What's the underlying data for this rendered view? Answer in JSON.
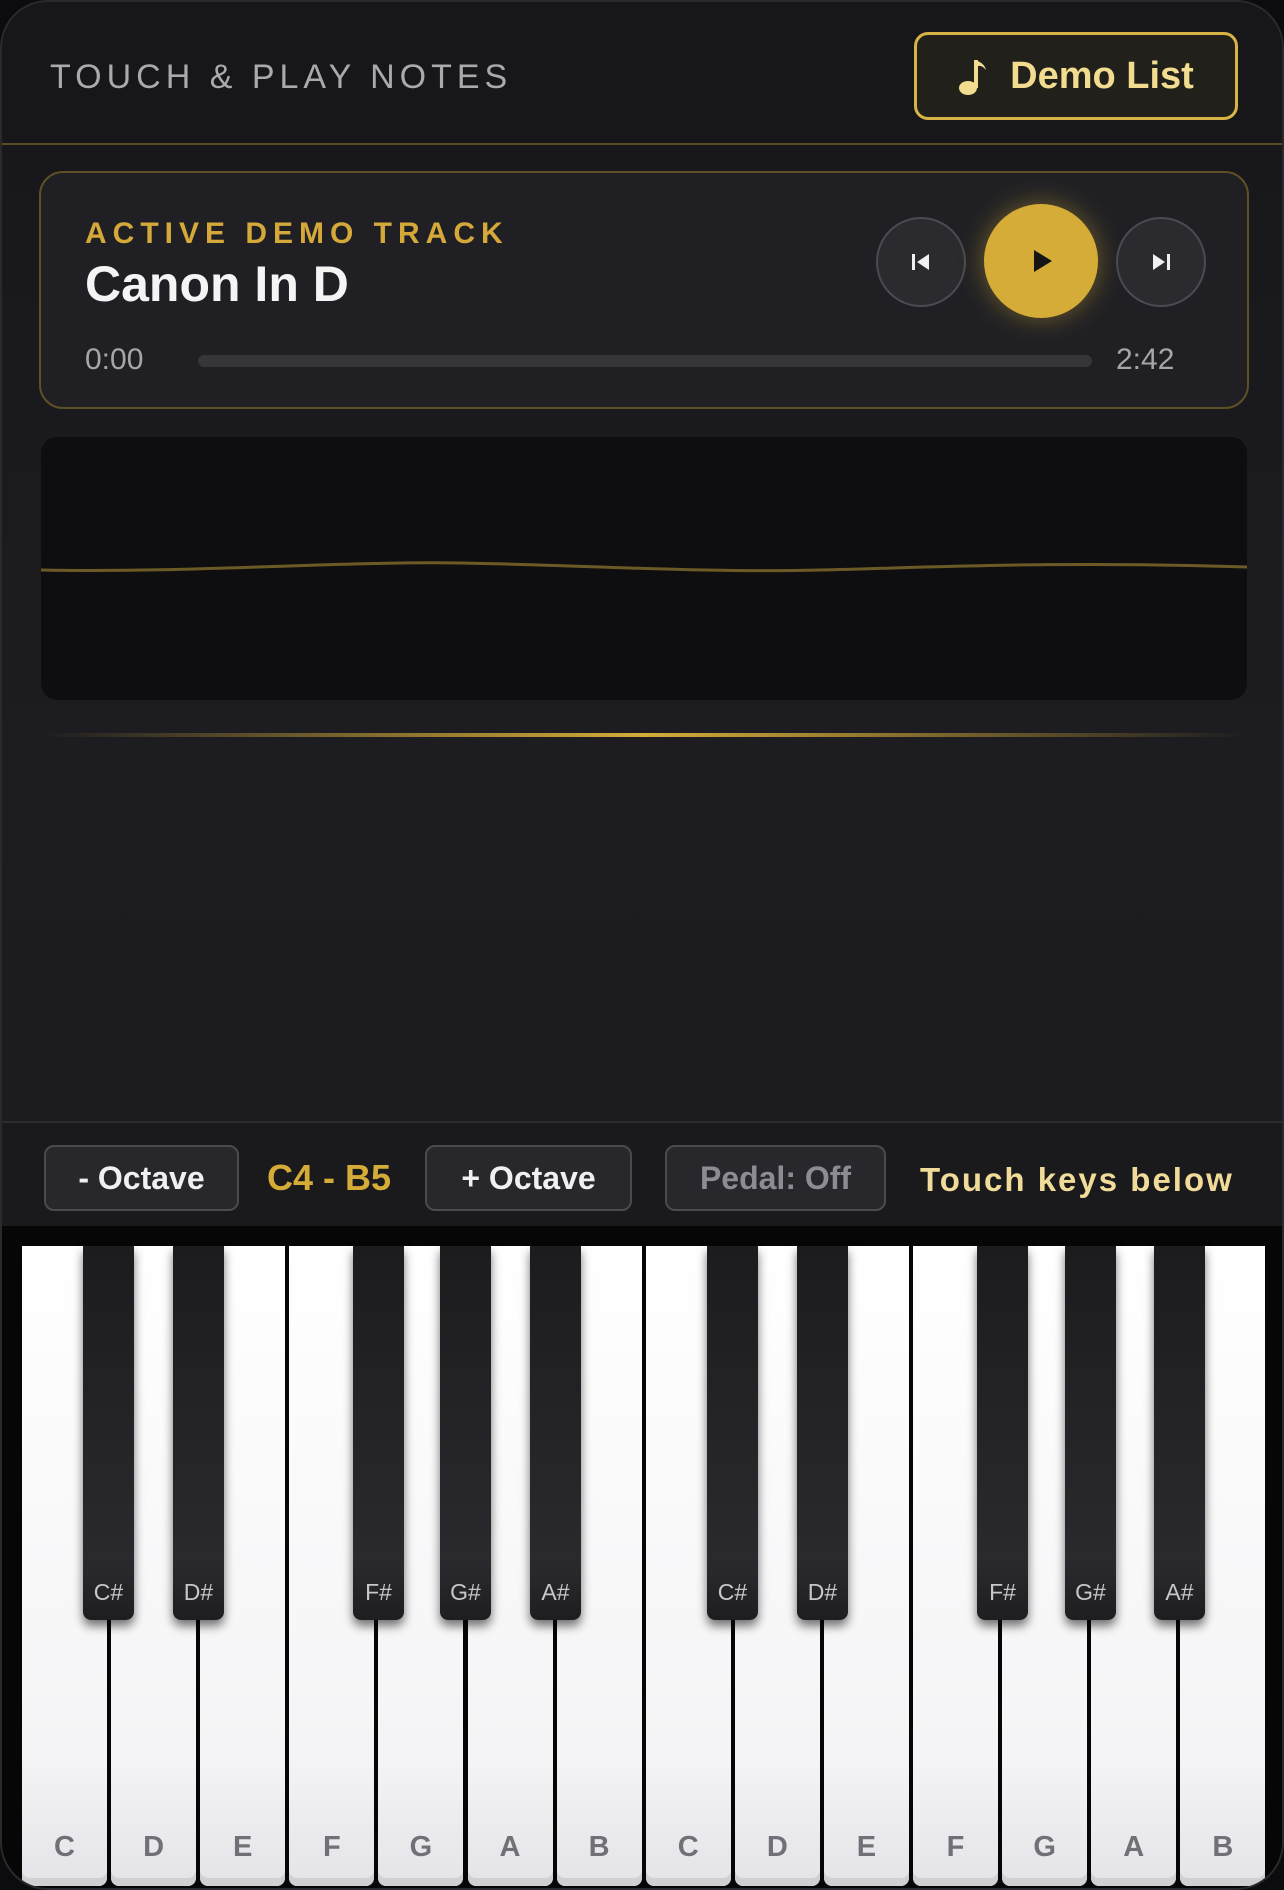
{
  "header": {
    "title": "TOUCH & PLAY NOTES",
    "demo_button_label": "Demo List",
    "demo_button_icon": "music-note-icon"
  },
  "player": {
    "kicker": "ACTIVE DEMO TRACK",
    "track_name": "Canon In D",
    "current_time": "0:00",
    "total_time": "2:42",
    "progress": 0,
    "controls": [
      "previous-track-icon",
      "play-icon",
      "next-track-icon"
    ]
  },
  "controls": {
    "octave_down_label": "- Octave",
    "range_label": "C4 - B5",
    "octave_up_label": "+ Octave",
    "pedal_label": "Pedal: Off",
    "hint": "Touch keys below"
  },
  "keyboard": {
    "white_keys": [
      "C",
      "D",
      "E",
      "F",
      "G",
      "A",
      "B",
      "C",
      "D",
      "E",
      "F",
      "G",
      "A",
      "B"
    ],
    "black_keys": [
      "C#",
      "D#",
      "F#",
      "G#",
      "A#",
      "C#",
      "D#",
      "F#",
      "G#",
      "A#"
    ]
  },
  "colors": {
    "accent": "#d6ac38",
    "accent_light": "#f0dc98",
    "background": "#1a1a1d"
  }
}
